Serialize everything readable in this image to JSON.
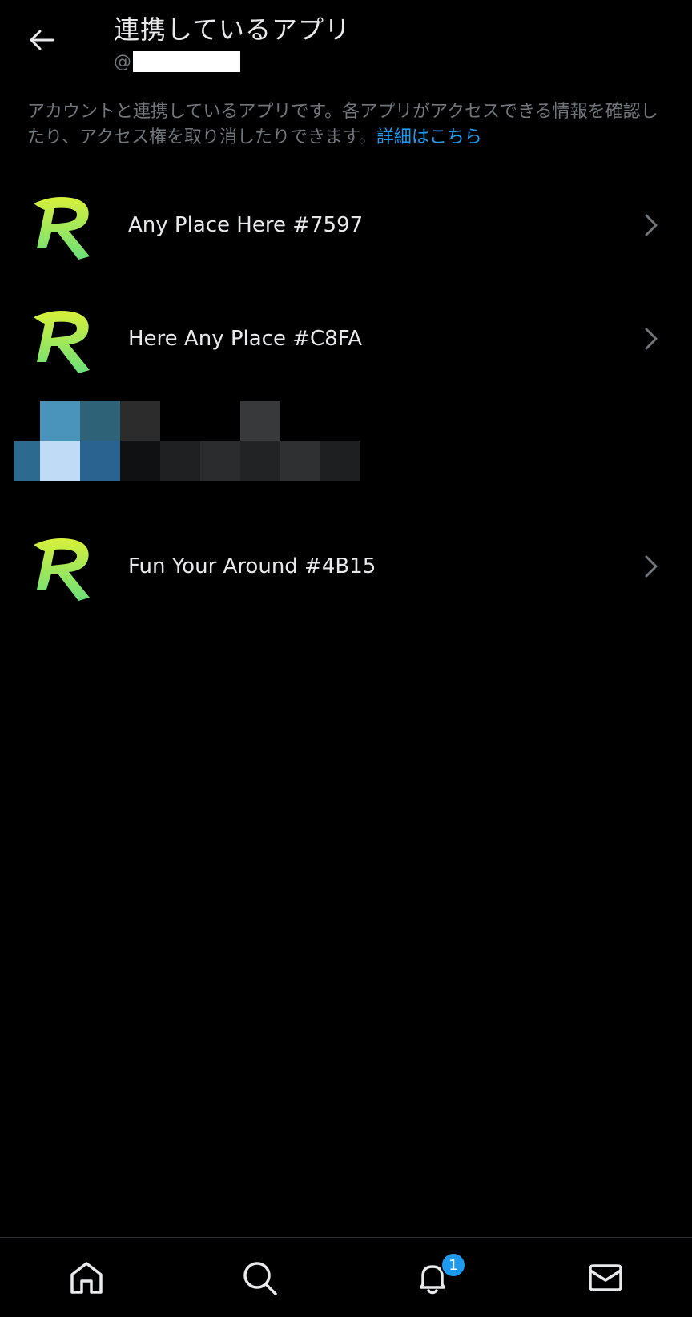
{
  "header": {
    "title": "連携しているアプリ",
    "handle_prefix": "@"
  },
  "description": {
    "text": "アカウントと連携しているアプリです。各アプリがアクセスできる情報を確認したり、アクセス権を取り消したりできます。",
    "link_label": "詳細はこちら"
  },
  "apps": [
    {
      "name": "Any Place Here #7597",
      "icon": "app-r-logo"
    },
    {
      "name": "Here Any Place #C8FA",
      "icon": "app-r-logo"
    },
    {
      "name": "Fun Your Around #4B15",
      "icon": "app-r-logo"
    }
  ],
  "bottom_nav": {
    "items": [
      "home-icon",
      "search-icon",
      "notifications-icon",
      "messages-icon"
    ],
    "notification_count": "1"
  },
  "colors": {
    "background": "#000000",
    "accent": "#1d9bf0",
    "secondary_text": "#71767b",
    "logo_green": "#8ee84a",
    "logo_yellow": "#d8f03a"
  }
}
